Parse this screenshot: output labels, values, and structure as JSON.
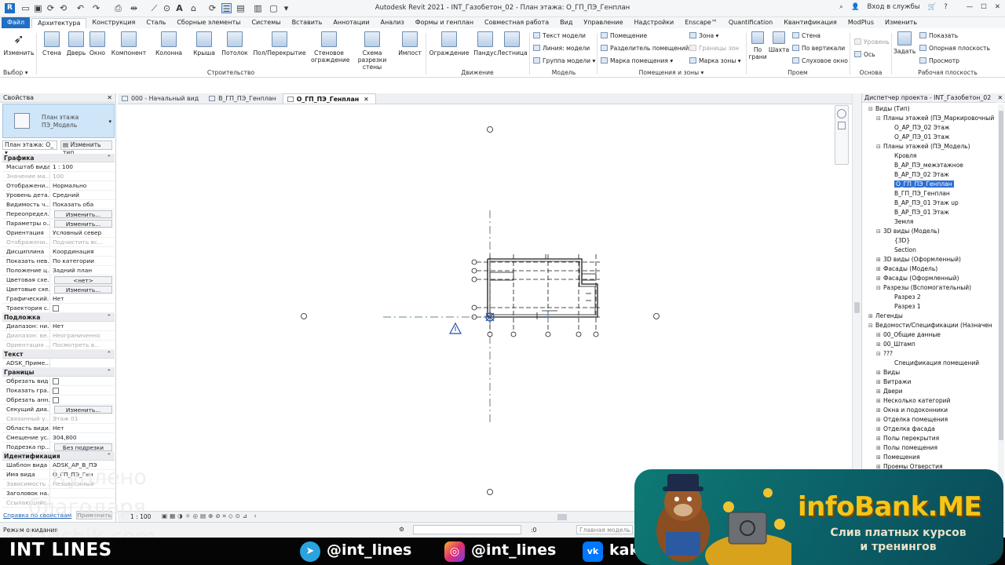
{
  "titlebar": {
    "title": "Autodesk Revit 2021 - INT_Газобетон_02 - План этажа: О_ГП_ПЭ_Генплан",
    "signin": "Вход в службы"
  },
  "ribbon_tabs": [
    "Файл",
    "Архитектура",
    "Конструкция",
    "Сталь",
    "Сборные элементы",
    "Системы",
    "Вставить",
    "Аннотации",
    "Анализ",
    "Формы и генплан",
    "Совместная работа",
    "Вид",
    "Управление",
    "Надстройки",
    "Enscape™",
    "Quantification",
    "Квантификация",
    "ModPlus",
    "Изменить"
  ],
  "ribbon_active_tab": "Архитектура",
  "ribbon": {
    "modify": "Изменить",
    "select_group": "Выбор",
    "build": {
      "wall": "Стена",
      "door": "Дверь",
      "window": "Окно",
      "component": "Компонент",
      "column": "Колонна",
      "roof": "Крыша",
      "ceiling": "Потолок",
      "floor": "Пол/Перекрытие",
      "curtain_system": "Стеновое ограждение",
      "curtain_grid": "Схема разрезки стены",
      "mullion": "Импост",
      "group": "Строительство"
    },
    "circulation": {
      "railing": "Ограждение",
      "ramp": "Пандус",
      "stair": "Лестница",
      "group": "Движение"
    },
    "model": {
      "model_text": "Текст модели",
      "model_line": "Линия: модели",
      "model_group": "Группа модели",
      "group": "Модель"
    },
    "room": {
      "room": "Помещение",
      "room_separator": "Разделитель помещений",
      "room_tag": "Марка помещения",
      "area": "Зона",
      "area_boundary": "Границы зон",
      "area_tag": "Марка зоны",
      "group": "Помещения и зоны"
    },
    "opening": {
      "by_face": "По грани",
      "shaft": "Шахта",
      "wall": "Стена",
      "vertical": "По вертикали",
      "dormer": "Слуховое окно",
      "group": "Проем"
    },
    "datum": {
      "level": "Уровень",
      "grid": "Ось",
      "group": "Основа"
    },
    "workplane": {
      "set": "Задать",
      "show": "Показать",
      "ref_plane": "Опорная плоскость",
      "viewer": "Просмотр",
      "group": "Рабочая плоскость"
    }
  },
  "properties": {
    "header": "Свойства",
    "type_name_1": "План этажа",
    "type_name_2": "ПЭ_Модель",
    "selector": "План этажа: О_",
    "edit_type": "Изменить тип",
    "rows": [
      {
        "cat": "Графика"
      },
      {
        "k": "Масштаб вида",
        "v": "1 : 100"
      },
      {
        "k": "Значение ма...",
        "v": "100",
        "dim": true
      },
      {
        "k": "Отображени...",
        "v": "Нормально"
      },
      {
        "k": "Уровень дета...",
        "v": "Средний"
      },
      {
        "k": "Видимость ч...",
        "v": "Показать оба"
      },
      {
        "k": "Переопредел...",
        "v": "Изменить...",
        "btn": true
      },
      {
        "k": "Параметры о...",
        "v": "Изменить...",
        "btn": true
      },
      {
        "k": "Ориентация",
        "v": "Условный север"
      },
      {
        "k": "Отображени...",
        "v": "Подчистить вс...",
        "dim": true
      },
      {
        "k": "Дисциплина",
        "v": "Координация"
      },
      {
        "k": "Показать нев...",
        "v": "По категории"
      },
      {
        "k": "Положение ц...",
        "v": "Задний план"
      },
      {
        "k": "Цветовая схе...",
        "v": "<нет>",
        "btn": true
      },
      {
        "k": "Цветовые схе...",
        "v": "Изменить...",
        "btn": true
      },
      {
        "k": "Графический...",
        "v": "Нет"
      },
      {
        "k": "Траектория с...",
        "v": "",
        "chk": true
      },
      {
        "cat": "Подложка"
      },
      {
        "k": "Диапазон: ни...",
        "v": "Нет"
      },
      {
        "k": "Диапазон: ве...",
        "v": "Неограниченно",
        "dim": true
      },
      {
        "k": "Ориентация ...",
        "v": "Посмотреть в...",
        "dim": true
      },
      {
        "cat": "Текст"
      },
      {
        "k": "ADSK_Приме...",
        "v": ""
      },
      {
        "cat": "Границы"
      },
      {
        "k": "Обрезать вид",
        "v": "",
        "chk": true
      },
      {
        "k": "Показать гра...",
        "v": "",
        "chk": true
      },
      {
        "k": "Обрезать анн...",
        "v": "",
        "chk": true
      },
      {
        "k": "Секущий диа...",
        "v": "Изменить...",
        "btn": true
      },
      {
        "k": "Связанный у...",
        "v": "Этаж 01",
        "dim": true
      },
      {
        "k": "Область види...",
        "v": "Нет"
      },
      {
        "k": "Смещение ус...",
        "v": "304,800"
      },
      {
        "k": "Подрезка пр...",
        "v": "Без подрезки",
        "btn": true
      },
      {
        "cat": "Идентификация"
      },
      {
        "k": "Шаблон вида",
        "v": "ADSK_АР_В_ПЭ"
      },
      {
        "k": "Имя вида",
        "v": "О_ГП_ПЭ_Ген"
      },
      {
        "k": "Зависимость ...",
        "v": "Независимый",
        "dim": true
      },
      {
        "k": "Заголовок на...",
        "v": ""
      },
      {
        "k": "Ссылающийс...",
        "v": "",
        "dim": true
      }
    ],
    "help_link": "Справка по свойствам",
    "apply": "Применить"
  },
  "view_tabs": [
    {
      "label": "000 - Начальный вид",
      "active": false
    },
    {
      "label": "В_ГП_ПЭ_Генплан",
      "active": false
    },
    {
      "label": "О_ГП_ПЭ_Генплан",
      "active": true
    }
  ],
  "view_bar": {
    "scale": "1 : 100"
  },
  "status_bar": {
    "text": "Режим ожидания",
    "zero": ":0",
    "model": "Главная модель"
  },
  "browser": {
    "header": "Диспетчер проекта - INT_Газобетон_02",
    "items": [
      {
        "label": "Виды (Тип)",
        "lvl": 0,
        "tg": "⊟"
      },
      {
        "label": "Планы этажей (ПЭ_Маркировочный",
        "lvl": 1,
        "tg": "⊟"
      },
      {
        "label": "О_АР_ПЭ_02 Этаж",
        "lvl": 2,
        "tg": ""
      },
      {
        "label": "О_АР_ПЭ_01 Этаж",
        "lvl": 2,
        "tg": ""
      },
      {
        "label": "Планы этажей (ПЭ_Модель)",
        "lvl": 1,
        "tg": "⊟"
      },
      {
        "label": "Кровля",
        "lvl": 2,
        "tg": ""
      },
      {
        "label": "В_АР_ПЭ_межэтажное",
        "lvl": 2,
        "tg": ""
      },
      {
        "label": "В_АР_ПЭ_02 Этаж",
        "lvl": 2,
        "tg": ""
      },
      {
        "label": "О_ГП_ПЭ_Генплан",
        "lvl": 2,
        "tg": "",
        "sel": true
      },
      {
        "label": "В_ГП_ПЭ_Генплан",
        "lvl": 2,
        "tg": ""
      },
      {
        "label": "В_АР_ПЭ_01 Этаж up",
        "lvl": 2,
        "tg": ""
      },
      {
        "label": "В_АР_ПЭ_01 Этаж",
        "lvl": 2,
        "tg": ""
      },
      {
        "label": "Земля",
        "lvl": 2,
        "tg": ""
      },
      {
        "label": "3D виды (Модель)",
        "lvl": 1,
        "tg": "⊟"
      },
      {
        "label": "{3D}",
        "lvl": 2,
        "tg": ""
      },
      {
        "label": "Section",
        "lvl": 2,
        "tg": ""
      },
      {
        "label": "3D виды (Оформленный)",
        "lvl": 1,
        "tg": "⊞"
      },
      {
        "label": "Фасады (Модель)",
        "lvl": 1,
        "tg": "⊞"
      },
      {
        "label": "Фасады (Оформленный)",
        "lvl": 1,
        "tg": "⊞"
      },
      {
        "label": "Разрезы (Вспомогательный)",
        "lvl": 1,
        "tg": "⊟"
      },
      {
        "label": "Разрез 2",
        "lvl": 2,
        "tg": ""
      },
      {
        "label": "Разрез 1",
        "lvl": 2,
        "tg": ""
      },
      {
        "label": "Легенды",
        "lvl": 0,
        "tg": "⊞"
      },
      {
        "label": "Ведомости/Спецификации (Назначен",
        "lvl": 0,
        "tg": "⊟"
      },
      {
        "label": "00_Общие данные",
        "lvl": 1,
        "tg": "⊞"
      },
      {
        "label": "00_Штамп",
        "lvl": 1,
        "tg": "⊞"
      },
      {
        "label": "???",
        "lvl": 1,
        "tg": "⊟"
      },
      {
        "label": "Спецификация помещений",
        "lvl": 2,
        "tg": ""
      },
      {
        "label": "Виды",
        "lvl": 1,
        "tg": "⊞"
      },
      {
        "label": "Витражи",
        "lvl": 1,
        "tg": "⊞"
      },
      {
        "label": "Двери",
        "lvl": 1,
        "tg": "⊞"
      },
      {
        "label": "Несколько категорий",
        "lvl": 1,
        "tg": "⊞"
      },
      {
        "label": "Окна и подоконники",
        "lvl": 1,
        "tg": "⊞"
      },
      {
        "label": "Отделка помещения",
        "lvl": 1,
        "tg": "⊞"
      },
      {
        "label": "Отделка фасада",
        "lvl": 1,
        "tg": "⊞"
      },
      {
        "label": "Полы перекрытия",
        "lvl": 1,
        "tg": "⊞"
      },
      {
        "label": "Полы помещения",
        "lvl": 1,
        "tg": "⊞"
      },
      {
        "label": "Помещения",
        "lvl": 1,
        "tg": "⊞"
      },
      {
        "label": "Проемы Отверстия",
        "lvl": 1,
        "tg": "⊞"
      }
    ]
  },
  "overlay": {
    "watermark_1": "Куплено",
    "watermark_2": "благодаря",
    "watermark_3": "skladchik.com",
    "brand": "INT LINES",
    "telegram": "@int_lines",
    "instagram": "@int_lines",
    "vk": "kak_",
    "banner_title": "infoBank.ME",
    "banner_sub_1": "Слив платных курсов",
    "banner_sub_2": "и тренингов"
  }
}
